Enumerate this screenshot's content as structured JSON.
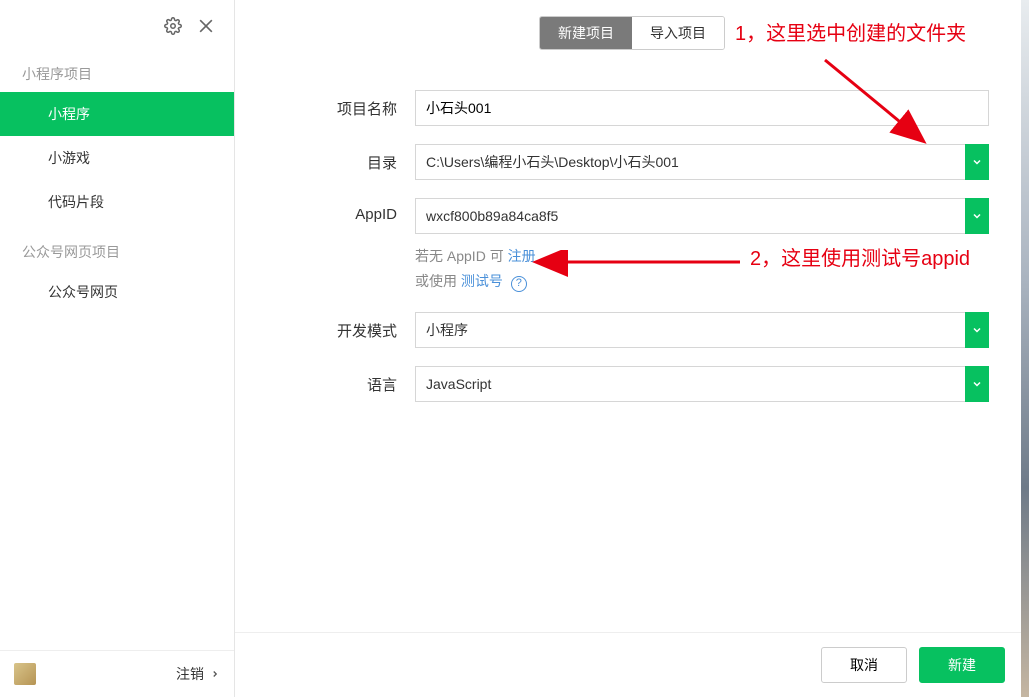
{
  "sidebar": {
    "section1": "小程序项目",
    "items1": [
      "小程序",
      "小游戏",
      "代码片段"
    ],
    "section2": "公众号网页项目",
    "items2": [
      "公众号网页"
    ],
    "logout": "注销"
  },
  "tabs": {
    "new": "新建项目",
    "import": "导入项目"
  },
  "form": {
    "project_name_label": "项目名称",
    "project_name_value": "小石头001",
    "dir_label": "目录",
    "dir_value": "C:\\Users\\编程小石头\\Desktop\\小石头001",
    "appid_label": "AppID",
    "appid_value": "wxcf800b89a84ca8f5",
    "hint_prefix": "若无 AppID 可 ",
    "hint_register": "注册",
    "hint_or": "或使用 ",
    "hint_test": "测试号",
    "mode_label": "开发模式",
    "mode_value": "小程序",
    "lang_label": "语言",
    "lang_value": "JavaScript"
  },
  "footer": {
    "cancel": "取消",
    "create": "新建"
  },
  "annotations": {
    "a1": "1，这里选中创建的文件夹",
    "a2": "2，这里使用测试号appid"
  }
}
